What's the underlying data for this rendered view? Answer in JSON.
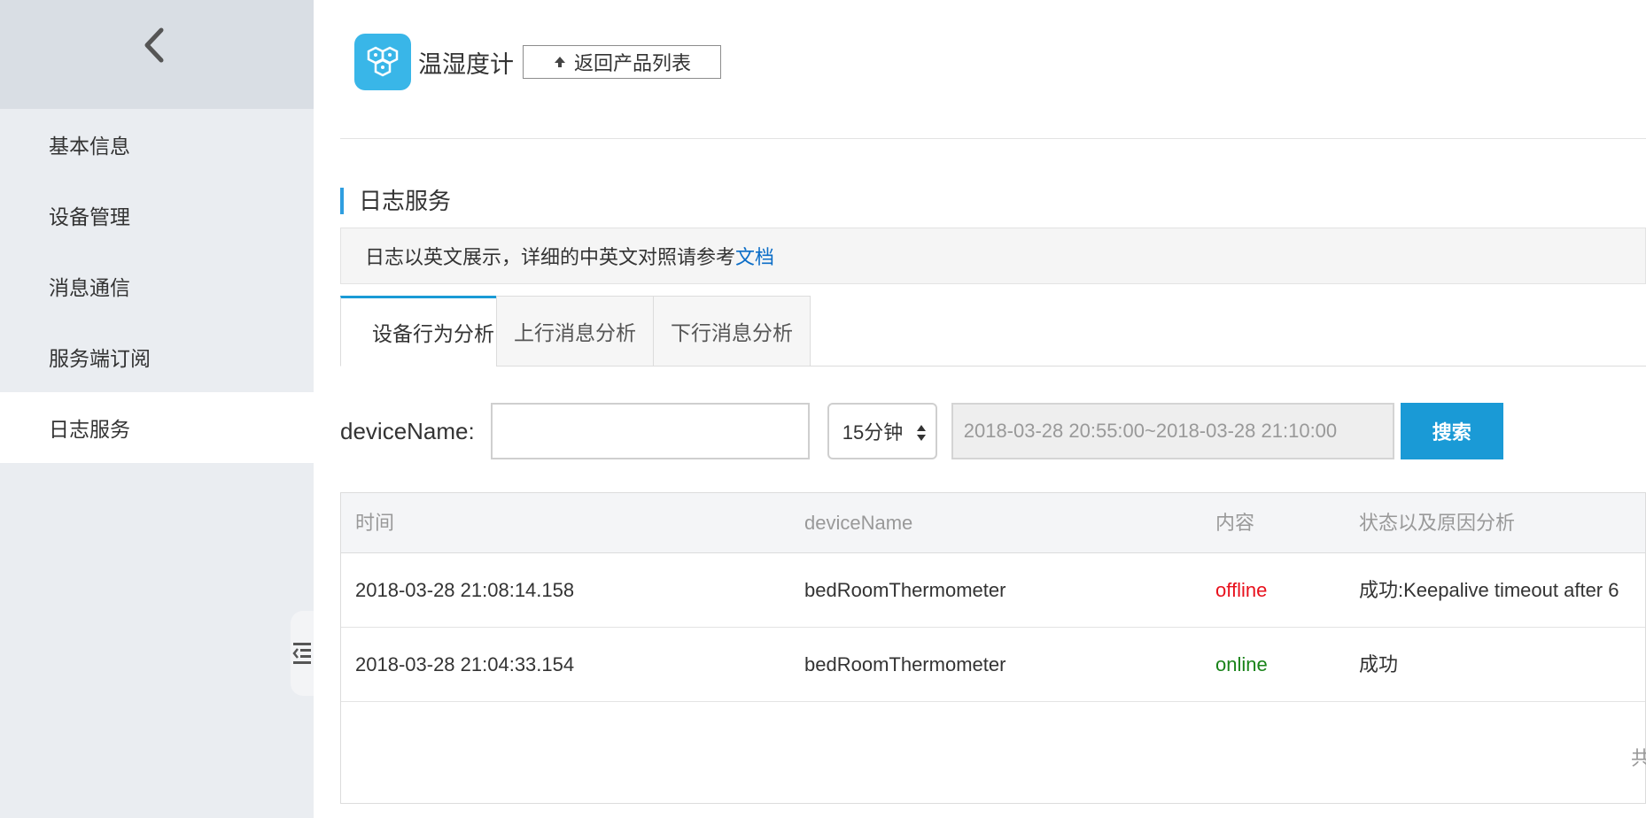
{
  "sidebar": {
    "items": [
      {
        "label": "基本信息"
      },
      {
        "label": "设备管理"
      },
      {
        "label": "消息通信"
      },
      {
        "label": "服务端订阅"
      },
      {
        "label": "日志服务"
      }
    ],
    "active_index": 4
  },
  "header": {
    "product_name": "温湿度计",
    "back_button_label": "返回产品列表"
  },
  "section": {
    "title": "日志服务"
  },
  "notice": {
    "text": "日志以英文展示，详细的中英文对照请参考",
    "link_text": "文档"
  },
  "tabs": [
    {
      "label": "设备行为分析",
      "active": true
    },
    {
      "label": "上行消息分析",
      "active": false
    },
    {
      "label": "下行消息分析",
      "active": false
    }
  ],
  "filter": {
    "label": "deviceName:",
    "device_value": "",
    "range_value": "15分钟",
    "date_range": "2018-03-28 20:55:00~2018-03-28 21:10:00",
    "search_label": "搜索"
  },
  "table": {
    "headers": [
      "时间",
      "deviceName",
      "内容",
      "状态以及原因分析"
    ],
    "rows": [
      {
        "time": "2018-03-28 21:08:14.158",
        "device": "bedRoomThermometer",
        "content": "offline",
        "status": "成功:Keepalive timeout after 6"
      },
      {
        "time": "2018-03-28 21:04:33.154",
        "device": "bedRoomThermometer",
        "content": "online",
        "status": "成功"
      }
    ],
    "pager_text": "共"
  },
  "colors": {
    "accent": "#1a9ad6",
    "offline": "#e8101c",
    "online": "#198319",
    "product_icon": "#39b6e8"
  }
}
